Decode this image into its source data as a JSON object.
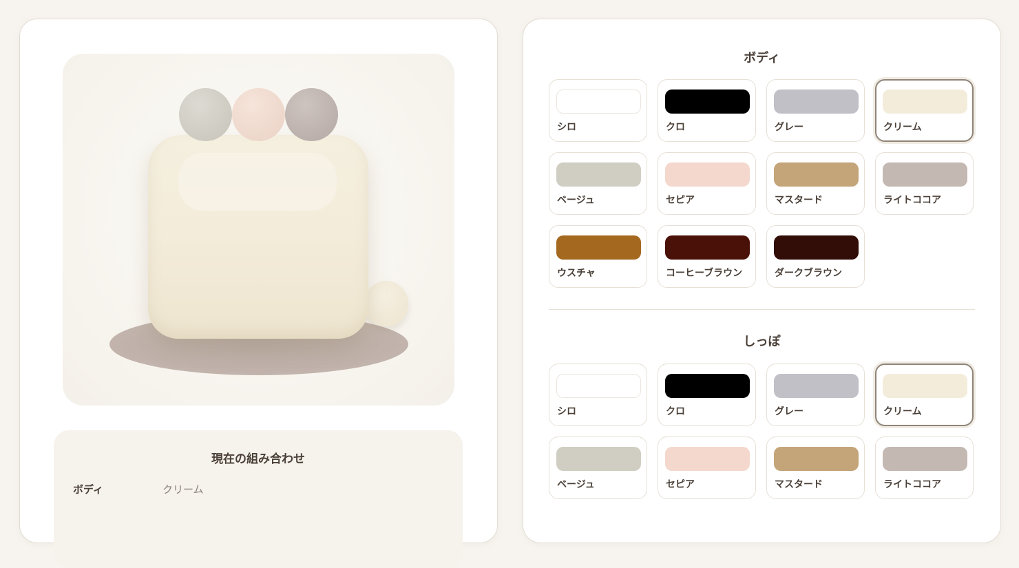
{
  "preview": {
    "body_color": "#f3ecda",
    "balls": [
      "#c7c4ba",
      "#ead2c5",
      "#b4a9a4"
    ]
  },
  "summary": {
    "title": "現在の組み合わせ",
    "rows": [
      {
        "key": "ボディ",
        "value": "クリーム"
      }
    ]
  },
  "sections": [
    {
      "title": "ボディ",
      "selected": "クリーム",
      "options": [
        {
          "label": "シロ",
          "color": "#ffffff"
        },
        {
          "label": "クロ",
          "color": "#000000"
        },
        {
          "label": "グレー",
          "color": "#c0c0c6"
        },
        {
          "label": "クリーム",
          "color": "#f3ecda"
        },
        {
          "label": "ベージュ",
          "color": "#d0cdc2"
        },
        {
          "label": "セピア",
          "color": "#f4d8cd"
        },
        {
          "label": "マスタード",
          "color": "#c4a57a"
        },
        {
          "label": "ライトココア",
          "color": "#c4b8b3"
        },
        {
          "label": "ウスチャ",
          "color": "#a4681f"
        },
        {
          "label": "コーヒーブラウン",
          "color": "#4a1109"
        },
        {
          "label": "ダークブラウン",
          "color": "#320c07"
        }
      ]
    },
    {
      "title": "しっぽ",
      "selected": "クリーム",
      "options": [
        {
          "label": "シロ",
          "color": "#ffffff"
        },
        {
          "label": "クロ",
          "color": "#000000"
        },
        {
          "label": "グレー",
          "color": "#c0c0c6"
        },
        {
          "label": "クリーム",
          "color": "#f3ecda"
        },
        {
          "label": "ベージュ",
          "color": "#d0cdc2"
        },
        {
          "label": "セピア",
          "color": "#f4d8cd"
        },
        {
          "label": "マスタード",
          "color": "#c4a57a"
        },
        {
          "label": "ライトココア",
          "color": "#c4b8b3"
        }
      ]
    }
  ]
}
